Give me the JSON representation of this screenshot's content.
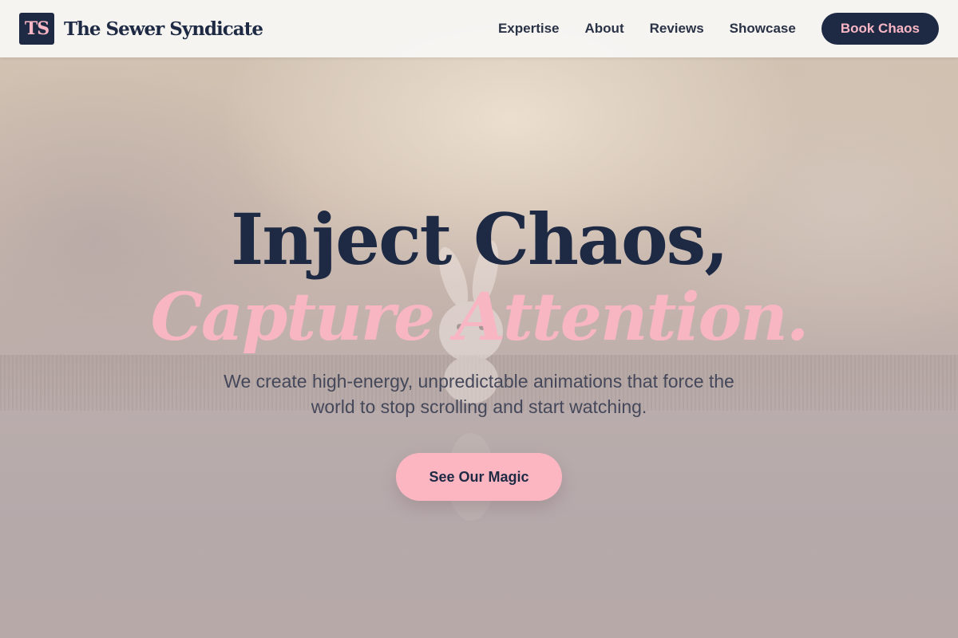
{
  "header": {
    "logo_initials": "TS",
    "brand_name": "The Sewer Syndicate",
    "nav": [
      "Expertise",
      "About",
      "Reviews",
      "Showcase"
    ],
    "cta_label": "Book Chaos"
  },
  "hero": {
    "headline_line_1": "Inject Chaos,",
    "headline_line_2": "Capture Attention.",
    "subtitle": "We create high-energy, unpredictable animations that force the world to stop scrolling and start watching.",
    "cta_label": "See Our Magic"
  },
  "colors": {
    "navy": "#1e2a44",
    "pink": "#f8b6c3",
    "header_bg": "#f8f6f4"
  }
}
